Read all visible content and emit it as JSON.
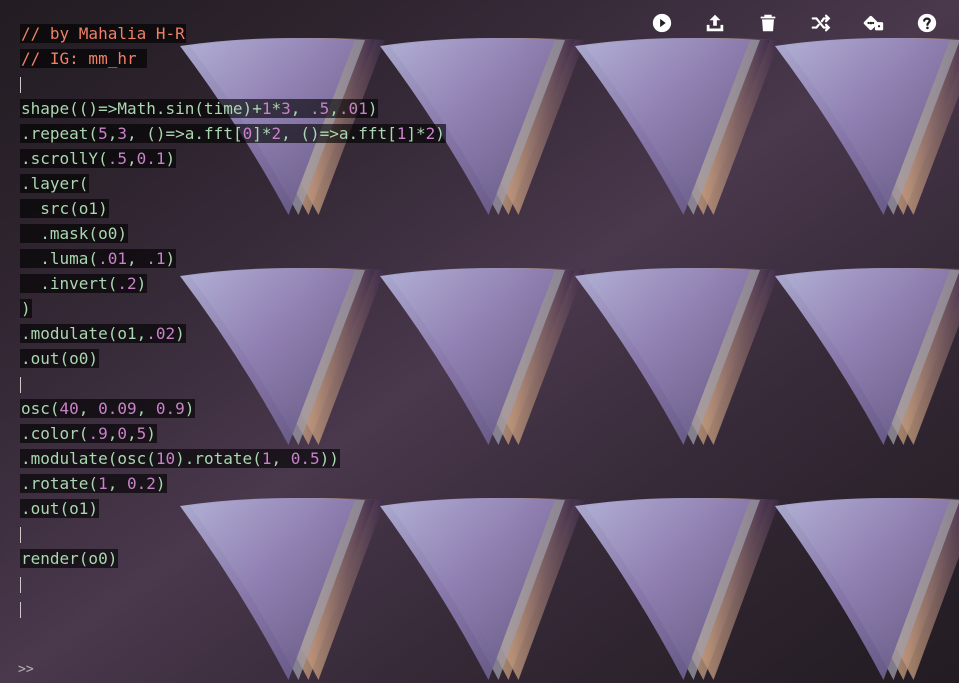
{
  "toolbar": {
    "buttons": [
      {
        "icon": "play-icon",
        "name": "run-button"
      },
      {
        "icon": "upload-icon",
        "name": "share-button"
      },
      {
        "icon": "trash-icon",
        "name": "clear-button"
      },
      {
        "icon": "shuffle-icon",
        "name": "random-sketch-button"
      },
      {
        "icon": "dice-icon",
        "name": "make-random-button"
      },
      {
        "icon": "help-icon",
        "name": "help-button"
      }
    ]
  },
  "editor": {
    "lines": [
      [
        [
          "comment",
          "// by Mahalia H-R"
        ]
      ],
      [
        [
          "comment",
          "// IG: mm_hr "
        ]
      ],
      [],
      [
        [
          "fn",
          "shape(()=>Math.sin(time)+"
        ],
        [
          "num",
          "1"
        ],
        [
          "fn",
          "*"
        ],
        [
          "num",
          "3"
        ],
        [
          "fn",
          ", "
        ],
        [
          "num",
          ".5"
        ],
        [
          "fn",
          ","
        ],
        [
          "num",
          ".01"
        ],
        [
          "fn",
          ")"
        ]
      ],
      [
        [
          "fn",
          ".repeat("
        ],
        [
          "num",
          "5"
        ],
        [
          "fn",
          ","
        ],
        [
          "num",
          "3"
        ],
        [
          "fn",
          ", ()=>a.fft["
        ],
        [
          "num",
          "0"
        ],
        [
          "fn",
          "]*"
        ],
        [
          "num",
          "2"
        ],
        [
          "fn",
          ", ()=>a.fft["
        ],
        [
          "num",
          "1"
        ],
        [
          "fn",
          "]*"
        ],
        [
          "num",
          "2"
        ],
        [
          "fn",
          ")"
        ]
      ],
      [
        [
          "fn",
          ".scrollY("
        ],
        [
          "num",
          ".5"
        ],
        [
          "fn",
          ","
        ],
        [
          "num",
          "0.1"
        ],
        [
          "fn",
          ")"
        ]
      ],
      [
        [
          "fn",
          ".layer("
        ]
      ],
      [
        [
          "fn",
          "  src(o1)"
        ]
      ],
      [
        [
          "fn",
          "  .mask(o0)"
        ]
      ],
      [
        [
          "fn",
          "  .luma("
        ],
        [
          "num",
          ".01"
        ],
        [
          "fn",
          ", "
        ],
        [
          "num",
          ".1"
        ],
        [
          "fn",
          ")"
        ]
      ],
      [
        [
          "fn",
          "  .invert("
        ],
        [
          "num",
          ".2"
        ],
        [
          "fn",
          ")"
        ]
      ],
      [
        [
          "fn",
          ")"
        ]
      ],
      [
        [
          "fn",
          ".modulate(o1,"
        ],
        [
          "num",
          ".02"
        ],
        [
          "fn",
          ")"
        ]
      ],
      [
        [
          "fn",
          ".out(o0)"
        ]
      ],
      [],
      [
        [
          "fn",
          "osc("
        ],
        [
          "num",
          "40"
        ],
        [
          "fn",
          ", "
        ],
        [
          "num",
          "0.09"
        ],
        [
          "fn",
          ", "
        ],
        [
          "num",
          "0.9"
        ],
        [
          "fn",
          ")"
        ]
      ],
      [
        [
          "fn",
          ".color("
        ],
        [
          "num",
          ".9"
        ],
        [
          "fn",
          ","
        ],
        [
          "num",
          "0"
        ],
        [
          "fn",
          ","
        ],
        [
          "num",
          "5"
        ],
        [
          "fn",
          ")"
        ]
      ],
      [
        [
          "fn",
          ".modulate(osc("
        ],
        [
          "num",
          "10"
        ],
        [
          "fn",
          ").rotate("
        ],
        [
          "num",
          "1"
        ],
        [
          "fn",
          ", "
        ],
        [
          "num",
          "0.5"
        ],
        [
          "fn",
          "))"
        ]
      ],
      [
        [
          "fn",
          ".rotate("
        ],
        [
          "num",
          "1"
        ],
        [
          "fn",
          ", "
        ],
        [
          "num",
          "0.2"
        ],
        [
          "fn",
          ")"
        ]
      ],
      [
        [
          "fn",
          ".out(o1)"
        ]
      ],
      [],
      [
        [
          "fn",
          "render(o0)"
        ]
      ],
      [],
      []
    ]
  },
  "prompt": ">>",
  "colors": {
    "comment": "#f07f65",
    "code": "#a9d7b0",
    "number": "#c883c8",
    "background": "#262025"
  }
}
